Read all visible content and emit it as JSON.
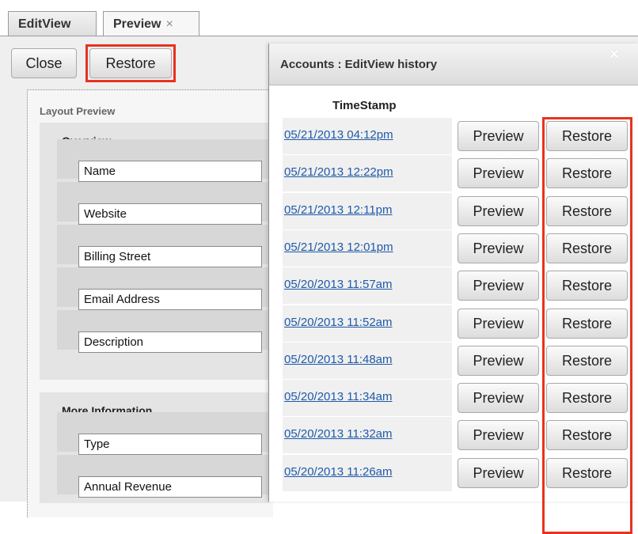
{
  "tabs": [
    {
      "label": "EditView"
    },
    {
      "label": "Preview",
      "close": "×"
    }
  ],
  "toolbar": {
    "close_label": "Close",
    "restore_label": "Restore"
  },
  "layout": {
    "title": "Layout Preview",
    "sections": [
      {
        "title": "Overview",
        "fields": [
          "Name",
          "Website",
          "Billing Street",
          "Email Address",
          "Description"
        ]
      },
      {
        "title": "More Information",
        "fields": [
          "Type",
          "Annual Revenue"
        ]
      }
    ]
  },
  "dialog": {
    "title": "Accounts : EditView history",
    "close": "×",
    "column_header": "TimeStamp",
    "preview_label": "Preview",
    "restore_label": "Restore",
    "rows": [
      "05/21/2013 04:12pm",
      "05/21/2013 12:22pm",
      "05/21/2013 12:11pm",
      "05/21/2013 12:01pm",
      "05/20/2013 11:57am",
      "05/20/2013 11:52am",
      "05/20/2013 11:48am",
      "05/20/2013 11:34am",
      "05/20/2013 11:32am",
      "05/20/2013 11:26am"
    ]
  },
  "colors": {
    "highlight": "#e8321f",
    "link": "#1f5aa8"
  }
}
